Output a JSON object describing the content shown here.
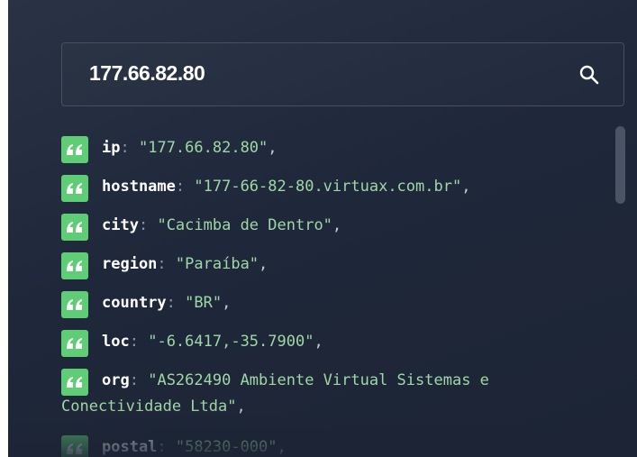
{
  "search": {
    "value": "177.66.82.80",
    "icon": "search-icon"
  },
  "colors": {
    "accent": "#5fcd75",
    "background": "#1f283a",
    "key": "#ffffff",
    "value": "#9fd7a6"
  },
  "fields": [
    {
      "key": "ip",
      "value": "\"177.66.82.80\""
    },
    {
      "key": "hostname",
      "value": "\"177-66-82-80.virtuax.com.br\""
    },
    {
      "key": "city",
      "value": "\"Cacimba de Dentro\""
    },
    {
      "key": "region",
      "value": "\"Paraíba\""
    },
    {
      "key": "country",
      "value": "\"BR\""
    },
    {
      "key": "loc",
      "value": "\"-6.6417,-35.7900\""
    },
    {
      "key": "org",
      "value_line1": "\"AS262490 Ambiente Virtual Sistemas e",
      "value_line2": "Conectividade Ltda\""
    },
    {
      "key": "postal",
      "value": "\"58230-000\""
    }
  ],
  "punct": {
    "colon": ":",
    "comma": ","
  }
}
